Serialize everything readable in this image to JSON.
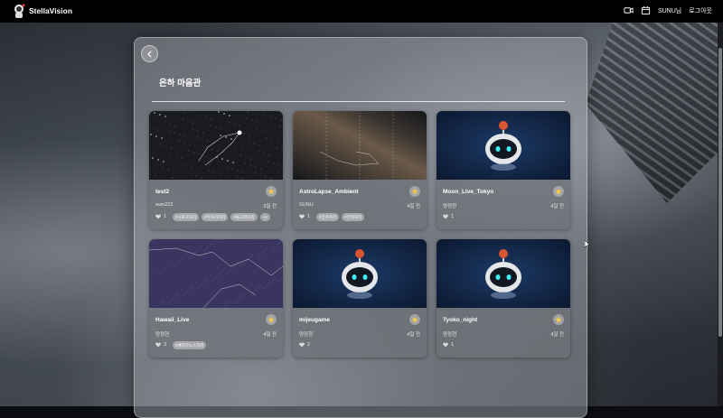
{
  "header": {
    "brand": "StellaVision",
    "user_label": "SUNU님",
    "logout_label": "로그아웃"
  },
  "page": {
    "title": "은하 마음관"
  },
  "cards": [
    {
      "title": "test2",
      "author": "wan223",
      "time": "3일 전",
      "likes": "1",
      "tags": [
        "#시로고자리",
        "#목수리자리",
        "#물고래자리",
        "+6"
      ],
      "thumb": "stars"
    },
    {
      "title": "AstroLapse_Ambient",
      "author": "SUNU",
      "time": "4일 전",
      "likes": "1",
      "tags": [
        "#궁수자리",
        "#전체자리"
      ],
      "thumb": "milkyway"
    },
    {
      "title": "Moon_Live_Tokyo",
      "author": "양정현",
      "time": "4일 전",
      "likes": "1",
      "tags": [],
      "thumb": "robot"
    },
    {
      "title": "Hawaii_Live",
      "author": "양정현",
      "time": "4일 전",
      "likes": "3",
      "tags": [
        "#페르다느스자리"
      ],
      "thumb": "purple"
    },
    {
      "title": "mijeugame",
      "author": "양정현",
      "time": "4일 전",
      "likes": "2",
      "tags": [],
      "thumb": "robot"
    },
    {
      "title": "Tyoko_night",
      "author": "양정현",
      "time": "4일 전",
      "likes": "1",
      "tags": [],
      "thumb": "robot"
    }
  ],
  "icons": {
    "back": "chevron-left-icon",
    "camera": "video-camera-icon",
    "calendar": "calendar-icon",
    "star": "star-icon",
    "heart": "heart-icon"
  }
}
